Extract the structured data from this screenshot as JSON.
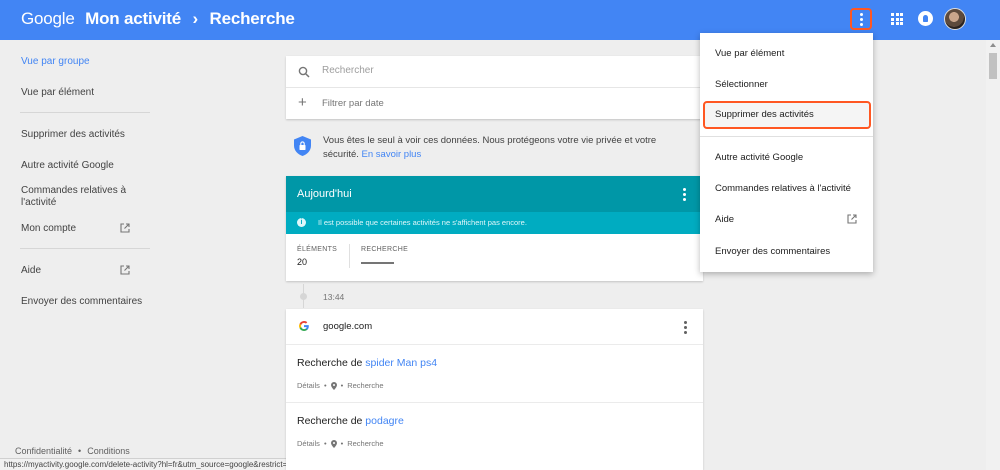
{
  "header": {
    "brand": "Google",
    "title": "Mon activité",
    "subtitle": "Recherche"
  },
  "sidebar": {
    "items": [
      {
        "label": "Vue par groupe"
      },
      {
        "label": "Vue par élément"
      },
      {
        "label": "Supprimer des activités"
      },
      {
        "label": "Autre activité Google"
      },
      {
        "label": "Commandes relatives à l'activité"
      },
      {
        "label": "Mon compte"
      },
      {
        "label": "Aide"
      },
      {
        "label": "Envoyer des commentaires"
      }
    ],
    "footer": {
      "privacy": "Confidentialité",
      "separator": "•",
      "terms": "Conditions"
    }
  },
  "search": {
    "placeholder": "Rechercher",
    "filter_label": "Filtrer par date"
  },
  "privacy_notice": {
    "text": "Vous êtes le seul à voir ces données. Nous protégeons votre vie privée et votre sécurité. ",
    "link": "En savoir plus"
  },
  "today_card": {
    "title": "Aujourd'hui",
    "info": "Il est possible que certaines activités ne s'affichent pas encore.",
    "stats": [
      {
        "label": "ÉLÉMENTS",
        "value": "20"
      },
      {
        "label": "RECHERCHE"
      }
    ]
  },
  "timeline": {
    "time": "13:44"
  },
  "activity_card": {
    "source": "google.com",
    "entries": [
      {
        "prefix": "Recherche de ",
        "query": "spider Man ps4",
        "details": "Détails",
        "dot": "•",
        "type": "Recherche"
      },
      {
        "prefix": "Recherche de ",
        "query": "podagre",
        "details": "Détails",
        "dot": "•",
        "type": "Recherche"
      }
    ]
  },
  "menu": {
    "items": [
      {
        "label": "Vue par élément"
      },
      {
        "label": "Sélectionner"
      },
      {
        "label": "Supprimer des activités"
      },
      {
        "label": "Autre activité Google"
      },
      {
        "label": "Commandes relatives à l'activité"
      },
      {
        "label": "Aide"
      },
      {
        "label": "Envoyer des commentaires"
      }
    ]
  },
  "status_bar": {
    "url": "https://myactivity.google.com/delete-activity?hl=fr&utm_source=google&restrict=search"
  },
  "colors": {
    "header": "#4285f4",
    "teal": "#0097a7",
    "highlight": "#ff5722",
    "link": "#4285f4"
  }
}
